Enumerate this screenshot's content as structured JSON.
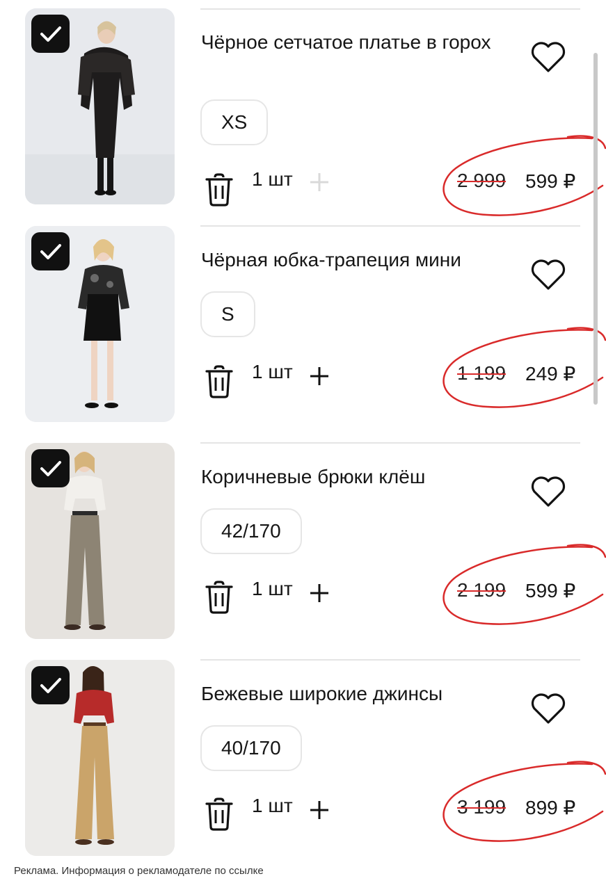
{
  "items": [
    {
      "title": "Чёрное сетчатое платье в горох",
      "size": "XS",
      "quantity": "1 шт",
      "old_price": "2 999",
      "new_price": "599 ₽",
      "selected": true,
      "plus_enabled": false
    },
    {
      "title": "Чёрная юбка-трапеция мини",
      "size": "S",
      "quantity": "1 шт",
      "old_price": "1 199",
      "new_price": "249 ₽",
      "selected": true,
      "plus_enabled": true
    },
    {
      "title": "Коричневые брюки клёш",
      "size": "42/170",
      "quantity": "1 шт",
      "old_price": "2 199",
      "new_price": "599 ₽",
      "selected": true,
      "plus_enabled": true
    },
    {
      "title": "Бежевые широкие джинсы",
      "size": "40/170",
      "quantity": "1 шт",
      "old_price": "3 199",
      "new_price": "899 ₽",
      "selected": true,
      "plus_enabled": true
    }
  ],
  "footer": {
    "ad_note": "Реклама. Информация о рекламодателе по ссылке"
  },
  "colors": {
    "checkbox_bg": "#111111",
    "annotation_red": "#d92a2a",
    "divider": "#e4e4e4",
    "plus_disabled": "#d9d9d9"
  },
  "icons": {
    "checkbox": "check-icon",
    "favorite": "heart-outline-icon",
    "delete": "trash-icon",
    "increase": "plus-icon"
  }
}
